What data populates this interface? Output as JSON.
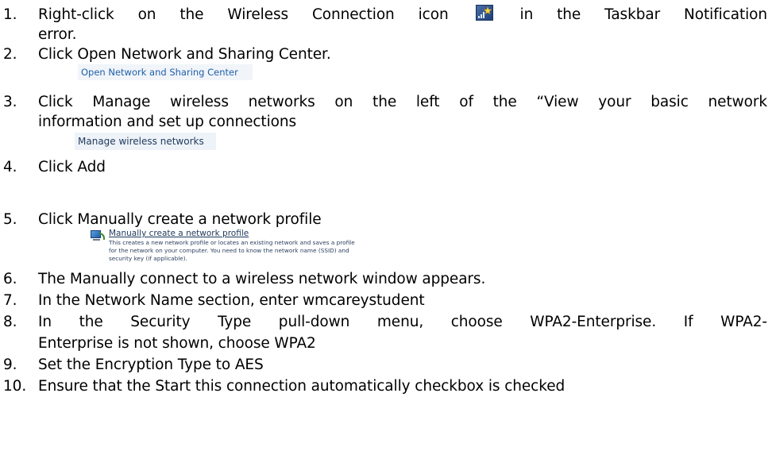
{
  "steps": [
    {
      "num": "1.",
      "line1_before": "Right-click on the Wireless Connection icon",
      "line1_after": "in the Taskbar Notification",
      "line2": "error."
    },
    {
      "num": "2.",
      "text": "Click Open Network and Sharing Center."
    },
    {
      "num": "3.",
      "line1": "Click Manage wireless networks on the left of the “View your basic network",
      "line2": "information and set up connections"
    },
    {
      "num": "4.",
      "text": "Click Add"
    },
    {
      "num": "5.",
      "text": "Click Manually create a network profile"
    },
    {
      "num": "6.",
      "text": "The Manually connect to a wireless network window appears."
    },
    {
      "num": "7.",
      "text": "In the Network Name section, enter wmcareystudent"
    },
    {
      "num": "8.",
      "line1": "In the Security Type pull-down menu, choose WPA2-Enterprise. If WPA2-",
      "line2": "Enterprise is not shown, choose WPA2"
    },
    {
      "num": "9.",
      "text": "Set the Encryption Type to AES"
    },
    {
      "num": "10.",
      "text": "Ensure that the Start this connection automatically checkbox is checked"
    }
  ],
  "screenshots": {
    "open_network_link": "Open Network and Sharing Center",
    "manage_wireless_link": "Manage wireless networks",
    "manual_profile": {
      "title": "Manually create a network profile",
      "description": "This creates a new network profile or locates an existing network and saves a profile for the network on your computer. You need to know the network name (SSID) and security key (if applicable)."
    }
  },
  "icons": {
    "wireless_connection": "wireless-connection-icon",
    "network_profile": "network-computer-icon"
  },
  "colors": {
    "text": "#000000",
    "link_blue": "#1f5fa8",
    "link_dark": "#1e395b",
    "link_bg": "#f1f5fa"
  }
}
